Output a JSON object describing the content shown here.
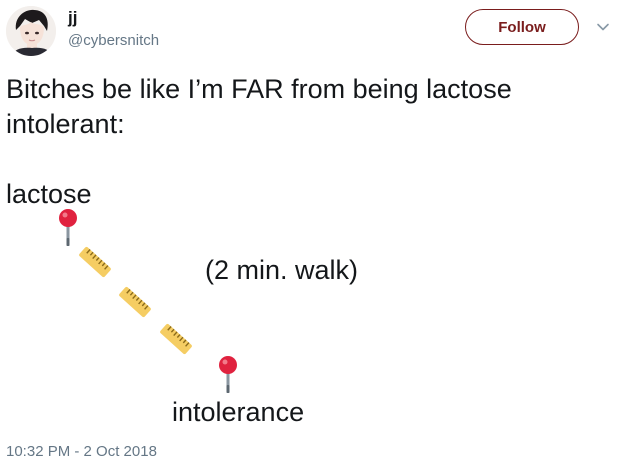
{
  "author": {
    "display_name": "jj",
    "handle": "@cybersnitch"
  },
  "actions": {
    "follow_label": "Follow"
  },
  "tweet": {
    "text": "Bitches be like I’m FAR from being lactose intolerant:",
    "label_start": "lactose",
    "label_distance": "(2 min. walk)",
    "label_end": "intolerance",
    "timestamp": "10:32 PM - 2 Oct 2018"
  },
  "icons": {
    "pin_start": "round-pushpin-icon",
    "ruler": "straight-ruler-icon",
    "pin_end": "round-pushpin-icon",
    "caret": "chevron-down-icon"
  },
  "colors": {
    "follow_accent": "#7a1d1d",
    "pin_red": "#e0223f",
    "ruler_yellow": "#f5cd63",
    "secondary_text": "#657786"
  }
}
